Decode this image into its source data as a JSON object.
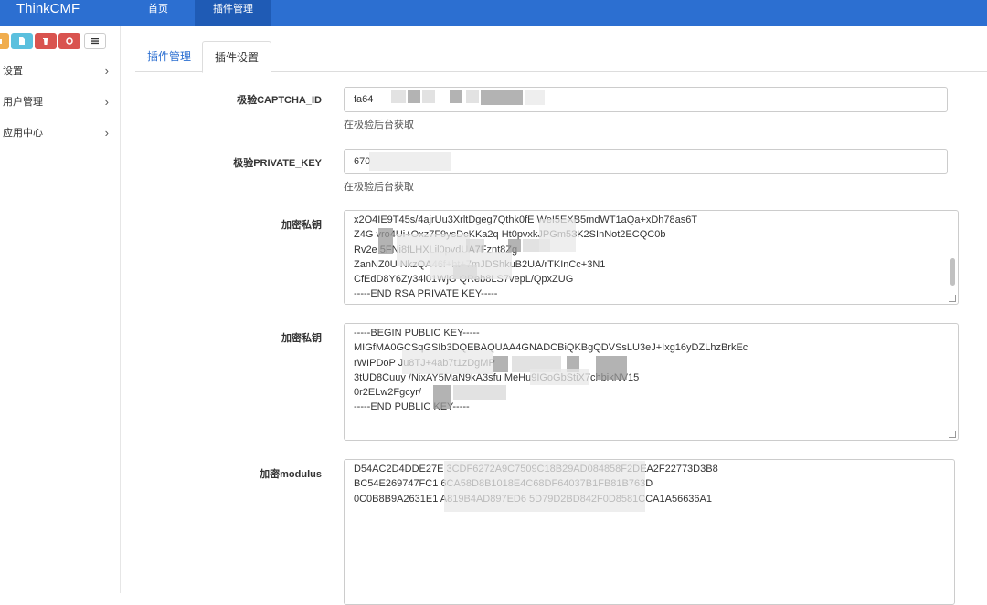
{
  "header": {
    "brand": "ThinkCMF",
    "nav": [
      {
        "label": "首页"
      },
      {
        "label": "插件管理"
      }
    ]
  },
  "sidebar": {
    "toolbar_icons": [
      "folder-icon",
      "file-icon",
      "trash-icon",
      "recycle-icon",
      "list-icon"
    ],
    "items": [
      {
        "label": "设置",
        "chevron": "›"
      },
      {
        "label": "用户管理",
        "chevron": "›"
      },
      {
        "label": "应用中心",
        "chevron": "›"
      }
    ]
  },
  "tabs": [
    {
      "label": "插件管理"
    },
    {
      "label": "插件设置"
    }
  ],
  "form": {
    "captcha_id": {
      "label": "极验CAPTCHA_ID",
      "value": "fa64",
      "help": "在极验后台获取"
    },
    "private_key": {
      "label": "极验PRIVATE_KEY",
      "value": "670",
      "help": "在极验后台获取"
    },
    "rsa_private": {
      "label": "加密私钥",
      "lines": [
        "x2O4IE9T45s/4ajrUu3XrltDgeg7Qthk0fE     WeI5EXB5mdWT1aQa+xDh78as6T",
        "Z4G    vro4Ui+Oxz7F9ysDcKKa2q                  Ht0pvxkJPGm53K2SInNot2ECQC0b",
        "Rv2e                                                                 5FNi8fLHXLil0pvdUA7Fznt8Zg",
        "ZanNZ0U                                              NkzQA46f+ht+7mJDShkuB2UA/rTKInCc+3N1",
        "CfEdD8Y6Zy34i01WjG            QReb8LS7vepL/QpxZUG",
        "-----END RSA PRIVATE KEY-----"
      ]
    },
    "public_key": {
      "label": "加密私钥",
      "lines": [
        "-----BEGIN PUBLIC KEY-----",
        "MIGfMA0GCSqGSIb3DQEBAQUAA4GNADCBiQKBgQDVSsLU3eJ+Ixg16yDZLhzBrkEc",
        "rWIPDoP                                                                        Ju8TJ+4ab7t1zDgMP",
        "3tUD8Cuuy         /NixAY5MaN9kA3sfu                      MeHu9IGoGbStiX7chbikNV15",
        "0r2ELw2Fgcyr/",
        "-----END PUBLIC KEY-----"
      ]
    },
    "modulus": {
      "label": "加密modulus",
      "lines": [
        "D54AC2D4DDE27E                                                        3CDF6272A9C7509C18B29AD084858F2DEA2F22773D3B8",
        "BC54E269747FC1                                                           6CA58D8B1018E4C68DF64037B1FB81B763D",
        "0C0B8B9A2631E1            A819B4AD897ED6            5D79D2BD842F0D8581CCA1A56636A1"
      ]
    }
  }
}
